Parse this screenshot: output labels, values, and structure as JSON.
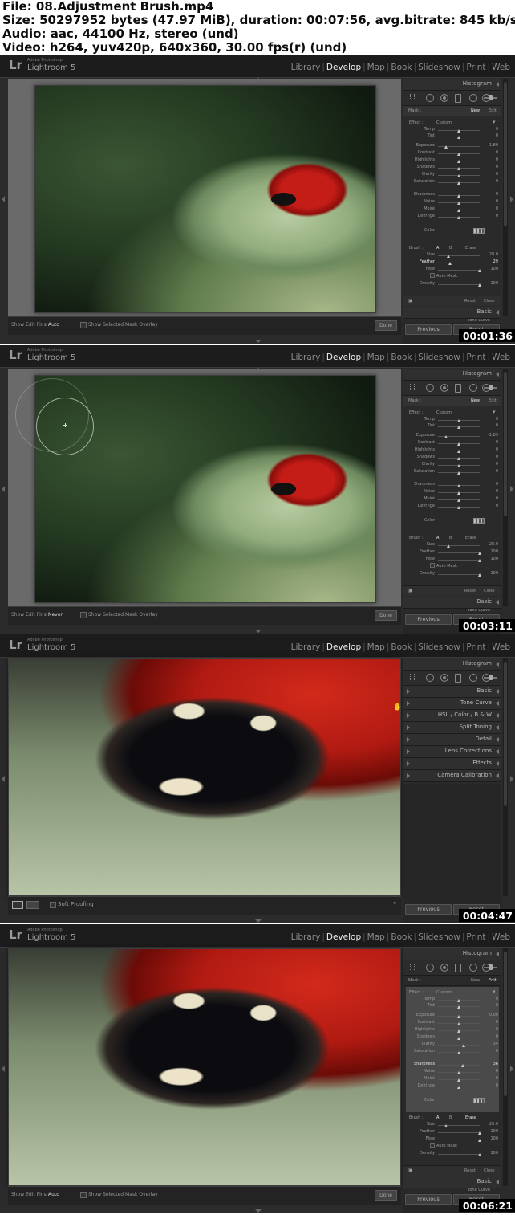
{
  "header": {
    "file": "File: 08.Adjustment Brush.mp4",
    "size": "Size: 50297952 bytes (47.97 MiB), duration: 00:07:56, avg.bitrate: 845 kb/s",
    "audio": "Audio: aac, 44100 Hz, stereo (und)",
    "video": "Video: h264, yuv420p, 640x360, 30.00 fps(r) (und)"
  },
  "app": {
    "logo": "Lr",
    "subtitle": "Adobe Photoshop",
    "name": "Lightroom 5",
    "modules": [
      "Library",
      "Develop",
      "Map",
      "Book",
      "Slideshow",
      "Print",
      "Web"
    ],
    "active_module": "Develop"
  },
  "panel_common": {
    "histogram": "Histogram",
    "basic": "Basic",
    "tone_curve": "Tone Curve",
    "previous": "Previous",
    "reset": "Reset",
    "mask": "Mask :",
    "new": "New",
    "edit": "Edit",
    "effect": "Effect :",
    "custom": "Custom",
    "color": "Color",
    "brush": "Brush :",
    "brush_a": "A",
    "brush_b": "B",
    "erase": "Erase",
    "auto_mask": "Auto Mask",
    "reset_btn": "Reset",
    "close_btn": "Close",
    "done": "Done",
    "show_edit_pins": "Show Edit Pins :",
    "show_mask_overlay": "Show Selected Mask Overlay"
  },
  "sliders": {
    "labels": [
      "Temp",
      "Tint",
      "Exposure",
      "Contrast",
      "Highlights",
      "Shadows",
      "Clarity",
      "Saturation",
      "Sharpness",
      "Noise",
      "Moiré",
      "Defringe"
    ],
    "brush_labels": [
      "Size",
      "Feather",
      "Flow",
      "Density"
    ]
  },
  "frames": [
    {
      "timestamp": "00:01:36",
      "show_edit_pins_value": "Auto",
      "slider_values": [
        "0",
        "0",
        "-1.89",
        "0",
        "0",
        "0",
        "0",
        "0",
        "0",
        "0",
        "0",
        "0"
      ],
      "slider_pos": [
        0.5,
        0.5,
        0.2,
        0.5,
        0.5,
        0.5,
        0.5,
        0.5,
        0.5,
        0.5,
        0.5,
        0.5
      ],
      "brush_values": [
        "28.0",
        "29",
        "100",
        "100"
      ],
      "brush_pos": [
        0.25,
        0.29,
        1.0,
        1.0
      ],
      "active_brush_row": 1,
      "mask_mode": "new"
    },
    {
      "timestamp": "00:03:11",
      "show_edit_pins_value": "Never",
      "slider_values": [
        "0",
        "0",
        "-1.89",
        "0",
        "0",
        "0",
        "0",
        "0",
        "0",
        "0",
        "0",
        "0"
      ],
      "slider_pos": [
        0.5,
        0.5,
        0.2,
        0.5,
        0.5,
        0.5,
        0.5,
        0.5,
        0.5,
        0.5,
        0.5,
        0.5
      ],
      "brush_values": [
        "28.0",
        "100",
        "100",
        "100"
      ],
      "brush_pos": [
        0.25,
        1.0,
        1.0,
        1.0
      ],
      "active_brush_row": -1,
      "mask_mode": "new"
    },
    {
      "timestamp": "00:04:47",
      "panel_sections": [
        "Basic",
        "Tone Curve",
        "HSL / Color / B & W",
        "Split Toning",
        "Detail",
        "Lens Corrections",
        "Effects",
        "Camera Calibration"
      ],
      "soft_proofing": "Soft Proofing"
    },
    {
      "timestamp": "00:06:21",
      "show_edit_pins_value": "Auto",
      "slider_values": [
        "0",
        "0",
        "0.00",
        "0",
        "0",
        "0",
        "34",
        "0",
        "36",
        "0",
        "0",
        "0"
      ],
      "slider_pos": [
        0.5,
        0.5,
        0.5,
        0.5,
        0.5,
        0.5,
        0.62,
        0.5,
        0.6,
        0.5,
        0.5,
        0.5
      ],
      "brush_values": [
        "20.0",
        "100",
        "100",
        "100"
      ],
      "brush_pos": [
        0.2,
        1.0,
        1.0,
        1.0
      ],
      "active_brush_row": -1,
      "active_slider": 8,
      "mask_mode": "edit"
    }
  ]
}
